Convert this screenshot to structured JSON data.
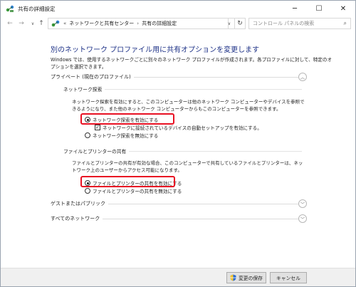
{
  "window": {
    "title": "共有の詳細設定",
    "minimize_glyph": "─",
    "maximize_glyph": "☐",
    "close_glyph": "✕"
  },
  "nav": {
    "back_glyph": "←",
    "forward_glyph": "→",
    "dropdown_glyph": "∨",
    "up_glyph": "↑",
    "breadcrumb": [
      "ネットワークと共有センター",
      "共有の詳細設定"
    ],
    "breadcrumb_prefix": "«",
    "breadcrumb_separator": "›",
    "refresh_glyph": "↻",
    "search_placeholder": "コントロール パネルの検索",
    "search_glyph": "⌕"
  },
  "main": {
    "heading": "別のネットワーク プロファイル用に共有オプションを変更します",
    "intro": "Windows では、使用するネットワークごとに別々のネットワーク プロファイルが作成されます。各プロファイルに対して、特定のオプションを選択できます。",
    "private_profile": {
      "title": "プライベート (現在のプロファイル)",
      "chevron_glyph": "︿",
      "network_discovery": {
        "title": "ネットワーク探索",
        "description": "ネットワーク探索を有効にすると、このコンピューターは他のネットワーク コンピューターやデバイスを参照できるようになり、また他のネットワーク コンピューターからもこのコンピューターを参照できます。",
        "option_on": "ネットワーク探索を有効にする",
        "option_auto_setup": "ネットワークに接続されているデバイスの自動セットアップを有効にする。",
        "option_off": "ネットワーク探索を無効にする",
        "checkbox_glyph": "✓"
      },
      "file_printer_sharing": {
        "title": "ファイルとプリンターの共有",
        "description": "ファイルとプリンターの共有が有効な場合、このコンピューターで共有しているファイルとプリンターは、ネットワーク上のユーザーからアクセス可能になります。",
        "option_on": "ファイルとプリンターの共有を有効にする",
        "option_off": "ファイルとプリンターの共有を無効にする"
      }
    },
    "guest_profile": {
      "title": "ゲストまたはパブリック",
      "chevron_glyph": "﹀"
    },
    "all_networks": {
      "title": "すべてのネットワーク",
      "chevron_glyph": "﹀"
    }
  },
  "footer": {
    "save_label": "変更の保存",
    "cancel_label": "キャンセル"
  },
  "colors": {
    "heading": "#1e3287",
    "highlight": "#e81123",
    "footer_bg": "#f0f0f0"
  }
}
